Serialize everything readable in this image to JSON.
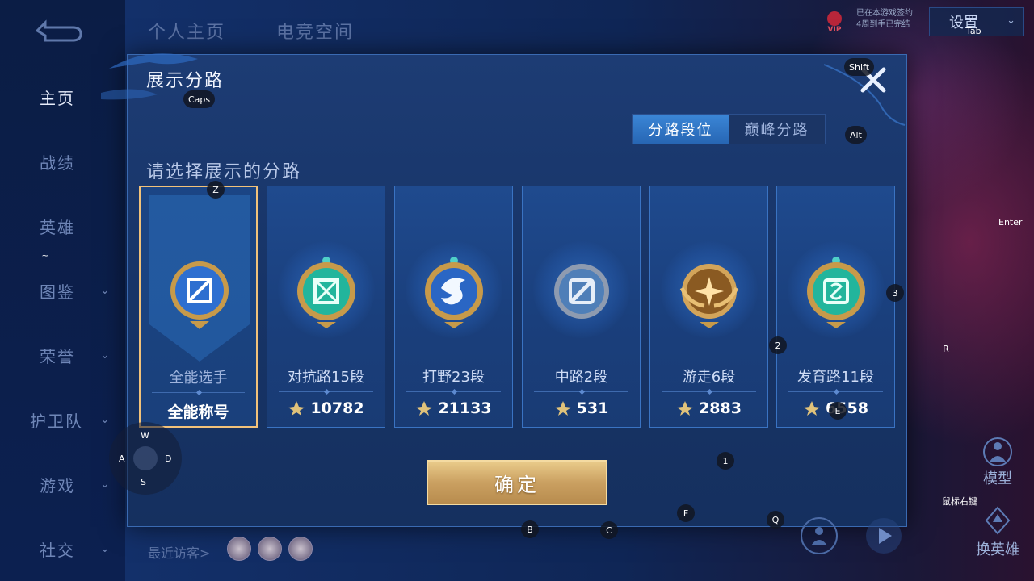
{
  "nav": {
    "items": [
      {
        "label": "主页",
        "active": true,
        "chevron": false
      },
      {
        "label": "战绩",
        "active": false,
        "chevron": false
      },
      {
        "label": "英雄",
        "active": false,
        "chevron": false
      },
      {
        "label": "图鉴",
        "active": false,
        "chevron": true
      },
      {
        "label": "荣誉",
        "active": false,
        "chevron": true
      },
      {
        "label": "护卫队",
        "active": false,
        "chevron": true
      },
      {
        "label": "游戏",
        "active": false,
        "chevron": true
      },
      {
        "label": "社交",
        "active": false,
        "chevron": true
      }
    ]
  },
  "top": {
    "tabs": [
      "个人主页",
      "电竞空间"
    ],
    "settings_label": "设置",
    "vip_label": "VIP",
    "vip_lines": [
      "已在本游戏签约",
      "4周到手已完结"
    ]
  },
  "modal": {
    "title": "展示分路",
    "subtitle": "请选择展示的分路",
    "segments": [
      {
        "label": "分路段位",
        "active": true
      },
      {
        "label": "巅峰分路",
        "active": false
      }
    ],
    "cards": [
      {
        "name": "全能选手",
        "score": "全能称号",
        "selected": true,
        "emblem": "all-round-icon"
      },
      {
        "name": "对抗路15段",
        "score": "10782",
        "selected": false,
        "emblem": "clash-lane-icon"
      },
      {
        "name": "打野23段",
        "score": "21133",
        "selected": false,
        "emblem": "jungle-icon"
      },
      {
        "name": "中路2段",
        "score": "531",
        "selected": false,
        "emblem": "mid-lane-icon"
      },
      {
        "name": "游走6段",
        "score": "2883",
        "selected": false,
        "emblem": "roam-icon"
      },
      {
        "name": "发育路11段",
        "score": "6558",
        "selected": false,
        "emblem": "farm-lane-icon"
      }
    ],
    "confirm_label": "确定"
  },
  "bottom": {
    "visitors_label": "最近访客>",
    "model_label": "模型",
    "change_hero_label": "换英雄"
  },
  "key_hints": {
    "caps": "Caps",
    "shift": "Shift",
    "tab": "Tab",
    "alt": "Alt",
    "enter": "Enter",
    "z": "Z",
    "tilde": "~",
    "three": "3",
    "two": "2",
    "r": "R",
    "e": "E",
    "one": "1",
    "f": "F",
    "q": "Q",
    "b": "B",
    "c": "C",
    "right_click": "鼠标右键",
    "w": "W",
    "a": "A",
    "s": "S",
    "d": "D"
  },
  "colors": {
    "accent_blue": "#2f78c8",
    "gold": "#d4a865",
    "selected_border": "#f2c27a"
  }
}
